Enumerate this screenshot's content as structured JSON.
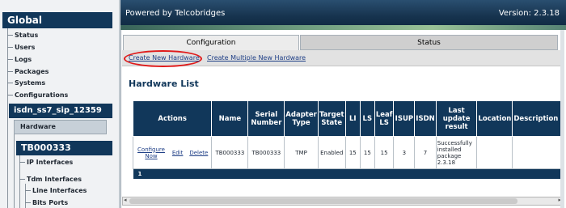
{
  "sidebar": {
    "global_header": "Global",
    "global_items": [
      "Status",
      "Users",
      "Logs",
      "Packages",
      "Systems",
      "Configurations"
    ],
    "config_header": "isdn_ss7_sip_12359",
    "hardware_item": "Hardware",
    "device_header": "TB000333",
    "ip_interfaces": "IP Interfaces",
    "tdm_interfaces": "Tdm Interfaces",
    "line_interfaces": "Line Interfaces",
    "bits_ports": "Bits Ports"
  },
  "banner": {
    "powered_by": "Powered by Telcobridges",
    "version": "Version: 2.3.18"
  },
  "tabs": {
    "configuration": "Configuration",
    "status": "Status"
  },
  "links": {
    "create_new": "Create New Hardware",
    "create_multiple": "Create Multiple New Hardware"
  },
  "hardware_list": {
    "title": "Hardware List",
    "columns": {
      "actions": "Actions",
      "name": "Name",
      "serial": "Serial Number",
      "adapter": "Adapter Type",
      "target": "Target State",
      "li": "LI",
      "ls": "LS",
      "leaf": "Leaf LS",
      "isup": "ISUP",
      "isdn": "ISDN",
      "last_update": "Last update result",
      "location": "Location",
      "description": "Description"
    },
    "row": {
      "configure": "Configure Now",
      "edit": "Edit",
      "delete": "Delete",
      "name": "TB000333",
      "serial": "TB000333",
      "adapter": "TMP",
      "target": "Enabled",
      "li": "15",
      "ls": "15",
      "leaf": "15",
      "isup": "3",
      "isdn": "7",
      "last_update": "Successfully installed package 2.3.18",
      "location": "",
      "description": ""
    },
    "footer_page": "1"
  },
  "colors": {
    "navy": "#11375a",
    "highlight": "#e01a1a",
    "link": "#1f3f86"
  }
}
